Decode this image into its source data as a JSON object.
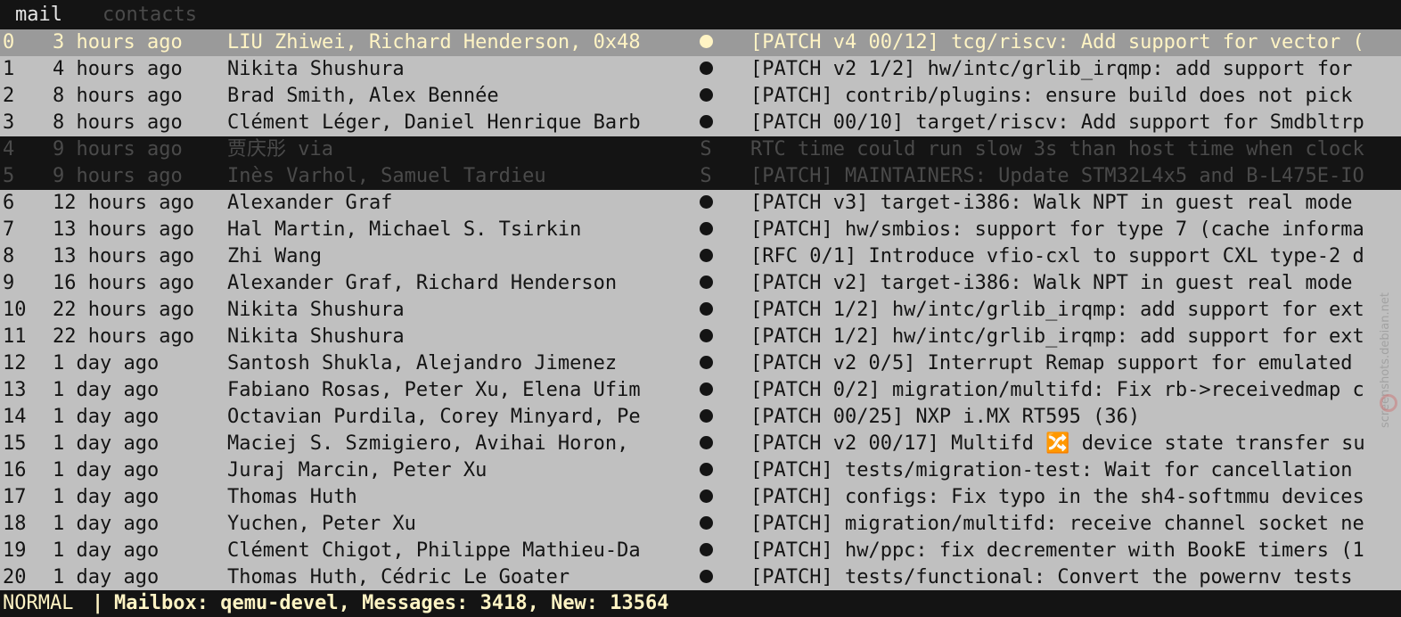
{
  "tabs": [
    {
      "label": "mail"
    },
    {
      "label": "contacts"
    }
  ],
  "rows": [
    {
      "idx": "0",
      "date": "3 hours ago",
      "from": "LIU Zhiwei, Richard Henderson, 0x48",
      "flag": "●",
      "subject": "[PATCH v4 00/12] tcg/riscv: Add support for vector (",
      "state": "selected"
    },
    {
      "idx": "1",
      "date": "4 hours ago",
      "from": "Nikita Shushura",
      "flag": "●",
      "subject": "[PATCH v2 1/2] hw/intc/grlib_irqmp: add support for",
      "state": "unread"
    },
    {
      "idx": "2",
      "date": "8 hours ago",
      "from": "Brad Smith, Alex Bennée",
      "flag": "●",
      "subject": "[PATCH] contrib/plugins: ensure build does not pick",
      "state": "unread"
    },
    {
      "idx": "3",
      "date": "8 hours ago",
      "from": "Clément Léger, Daniel Henrique Barb",
      "flag": "●",
      "subject": "[PATCH 00/10] target/riscv: Add support for Smdbltrp",
      "state": "unread"
    },
    {
      "idx": "4",
      "date": "9 hours ago",
      "from": "贾庆彤 via",
      "flag": "S",
      "subject": "RTC time could run slow 3s than host time when clock",
      "state": "seen"
    },
    {
      "idx": "5",
      "date": "9 hours ago",
      "from": "Inès Varhol, Samuel Tardieu",
      "flag": "S",
      "subject": "[PATCH] MAINTAINERS: Update STM32L4x5 and B-L475E-IO",
      "state": "seen"
    },
    {
      "idx": "6",
      "date": "12 hours ago",
      "from": "Alexander Graf",
      "flag": "●",
      "subject": "[PATCH v3] target-i386: Walk NPT in guest real mode",
      "state": "unread"
    },
    {
      "idx": "7",
      "date": "13 hours ago",
      "from": "Hal Martin, Michael S. Tsirkin",
      "flag": "●",
      "subject": "[PATCH] hw/smbios: support for type 7 (cache informa",
      "state": "unread"
    },
    {
      "idx": "8",
      "date": "13 hours ago",
      "from": "Zhi Wang",
      "flag": "●",
      "subject": "[RFC 0/1] Introduce vfio-cxl to support CXL type-2 d",
      "state": "unread"
    },
    {
      "idx": "9",
      "date": "16 hours ago",
      "from": "Alexander Graf, Richard Henderson",
      "flag": "●",
      "subject": "[PATCH v2] target-i386: Walk NPT in guest real mode",
      "state": "unread"
    },
    {
      "idx": "10",
      "date": "22 hours ago",
      "from": "Nikita Shushura",
      "flag": "●",
      "subject": "[PATCH 1/2] hw/intc/grlib_irqmp: add support for ext",
      "state": "unread"
    },
    {
      "idx": "11",
      "date": "22 hours ago",
      "from": "Nikita Shushura",
      "flag": "●",
      "subject": "[PATCH 1/2] hw/intc/grlib_irqmp: add support for ext",
      "state": "unread"
    },
    {
      "idx": "12",
      "date": "1 day ago",
      "from": "Santosh Shukla, Alejandro Jimenez",
      "flag": "●",
      "subject": "[PATCH v2 0/5] Interrupt Remap support for emulated",
      "state": "unread"
    },
    {
      "idx": "13",
      "date": "1 day ago",
      "from": "Fabiano Rosas, Peter Xu, Elena Ufim",
      "flag": "●",
      "subject": "[PATCH 0/2] migration/multifd: Fix rb->receivedmap c",
      "state": "unread"
    },
    {
      "idx": "14",
      "date": "1 day ago",
      "from": "Octavian Purdila, Corey Minyard, Pe",
      "flag": "●",
      "subject": "[PATCH 00/25] NXP i.MX RT595 (36)",
      "state": "unread"
    },
    {
      "idx": "15",
      "date": "1 day ago",
      "from": "Maciej S. Szmigiero, Avihai Horon,",
      "flag": "●",
      "subject": "[PATCH v2 00/17] Multifd 🔀 device state transfer su",
      "state": "unread"
    },
    {
      "idx": "16",
      "date": "1 day ago",
      "from": "Juraj Marcin, Peter Xu",
      "flag": "●",
      "subject": "[PATCH] tests/migration-test: Wait for cancellation",
      "state": "unread"
    },
    {
      "idx": "17",
      "date": "1 day ago",
      "from": "Thomas Huth",
      "flag": "●",
      "subject": "[PATCH] configs: Fix typo in the sh4-softmmu devices",
      "state": "unread"
    },
    {
      "idx": "18",
      "date": "1 day ago",
      "from": "Yuchen, Peter Xu",
      "flag": "●",
      "subject": "[PATCH] migration/multifd: receive channel socket ne",
      "state": "unread"
    },
    {
      "idx": "19",
      "date": "1 day ago",
      "from": "Clément Chigot, Philippe Mathieu-Da",
      "flag": "●",
      "subject": "[PATCH] hw/ppc: fix decrementer with BookE timers (1",
      "state": "unread"
    },
    {
      "idx": "20",
      "date": "1 day ago",
      "from": "Thomas Huth, Cédric Le Goater",
      "flag": "●",
      "subject": "[PATCH] tests/functional: Convert the powernv tests",
      "state": "unread"
    }
  ],
  "status": {
    "mode": "NORMAL",
    "separator": "|",
    "text": "Mailbox: qemu-devel, Messages: 3418, New: 13564"
  },
  "watermark": {
    "text": "screenshots.debian.net"
  },
  "colors": {
    "background": "#141414",
    "row_unread_bg": "#c0c0c0",
    "row_selected_bg": "#9a9a9a",
    "selected_text": "#fff4c4",
    "seen_text": "#4a4a4a",
    "status_text": "#fff4c4"
  }
}
